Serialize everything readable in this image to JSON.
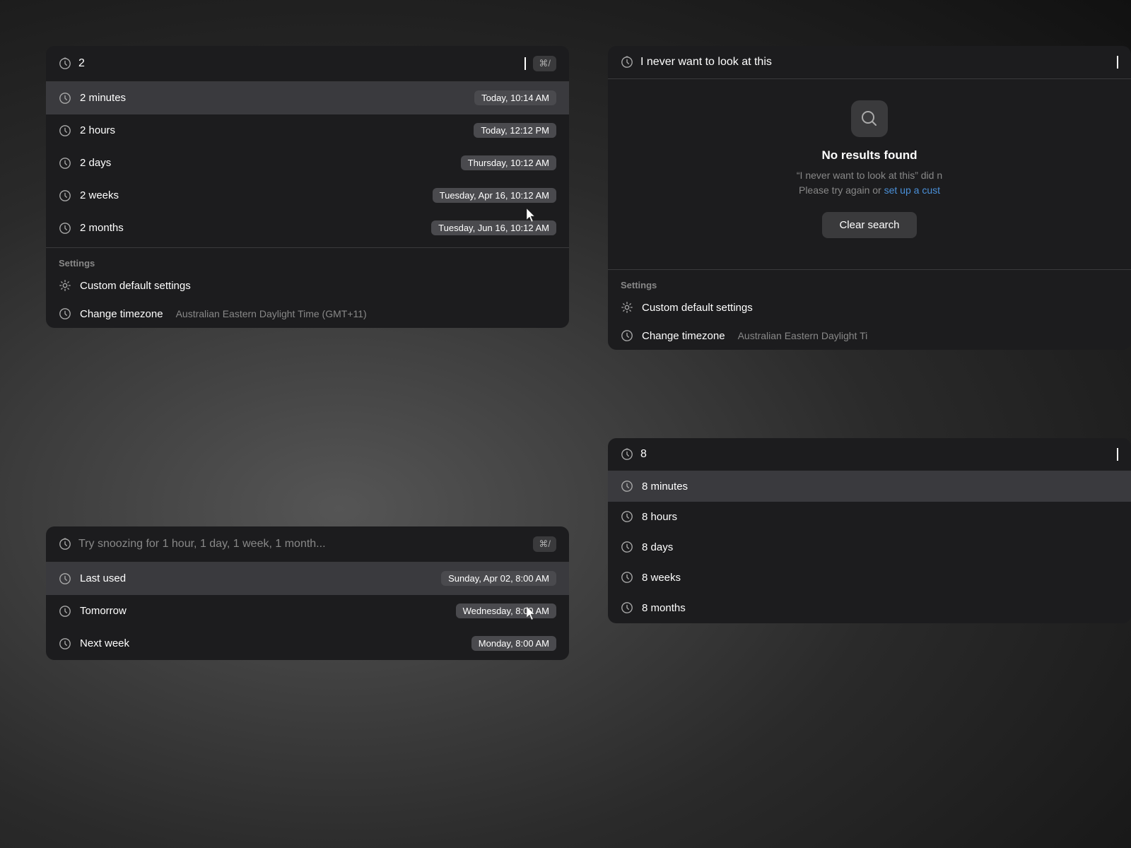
{
  "colors": {
    "panel_bg": "#1c1c1e",
    "selected_bg": "#3a3a3e",
    "date_badge_bg": "#4a4a4e",
    "settings_divider": "#3a3a3c"
  },
  "panel_top_left": {
    "search_placeholder": "Try snoozing for 1 hour, 1 day, 1 week, 1 month...",
    "kbd_shortcut": "⌘/",
    "query": "2",
    "results": [
      {
        "label": "2 minutes",
        "date": "Today, 10:14 AM",
        "selected": true
      },
      {
        "label": "2 hours",
        "date": "Today, 12:12 PM",
        "selected": false
      },
      {
        "label": "2 days",
        "date": "Thursday, 10:12 AM",
        "selected": false
      },
      {
        "label": "2 weeks",
        "date": "Tuesday, Apr 16, 10:12 AM",
        "selected": false
      },
      {
        "label": "2 months",
        "date": "Tuesday, Jun 16, 10:12 AM",
        "selected": false
      }
    ],
    "settings_header": "Settings",
    "settings_items": [
      {
        "label": "Custom default settings",
        "sublabel": "",
        "type": "gear"
      },
      {
        "label": "Change timezone",
        "sublabel": "Australian Eastern Daylight Time (GMT+11)",
        "type": "clock"
      }
    ]
  },
  "panel_top_right": {
    "query": "I never want to look at this",
    "no_results_title": "No results found",
    "no_results_desc_1": "“I never want to look at this” did n",
    "no_results_desc_2": "Please try again or",
    "no_results_link": "set up a cust",
    "clear_search_label": "Clear search",
    "settings_header": "Settings",
    "settings_items": [
      {
        "label": "Custom default settings",
        "sublabel": "",
        "type": "gear"
      },
      {
        "label": "Change timezone",
        "sublabel": "Australian Eastern Daylight Ti",
        "type": "clock"
      }
    ]
  },
  "panel_bottom_left": {
    "search_placeholder": "Try snoozing for 1 hour, 1 day, 1 week, 1 month...",
    "kbd_shortcut": "⌘/",
    "results": [
      {
        "label": "Last used",
        "date": "Sunday, Apr 02, 8:00 AM",
        "selected": true
      },
      {
        "label": "Tomorrow",
        "date": "Wednesday, 8:00 AM",
        "selected": false
      },
      {
        "label": "Next week",
        "date": "Monday, 8:00 AM",
        "selected": false
      }
    ]
  },
  "panel_bottom_right": {
    "query": "8",
    "results": [
      {
        "label": "8 minutes",
        "date": "",
        "selected": true
      },
      {
        "label": "8 hours",
        "date": "",
        "selected": false
      },
      {
        "label": "8 days",
        "date": "",
        "selected": false
      },
      {
        "label": "8 weeks",
        "date": "",
        "selected": false
      },
      {
        "label": "8 months",
        "date": "",
        "selected": false
      }
    ]
  }
}
